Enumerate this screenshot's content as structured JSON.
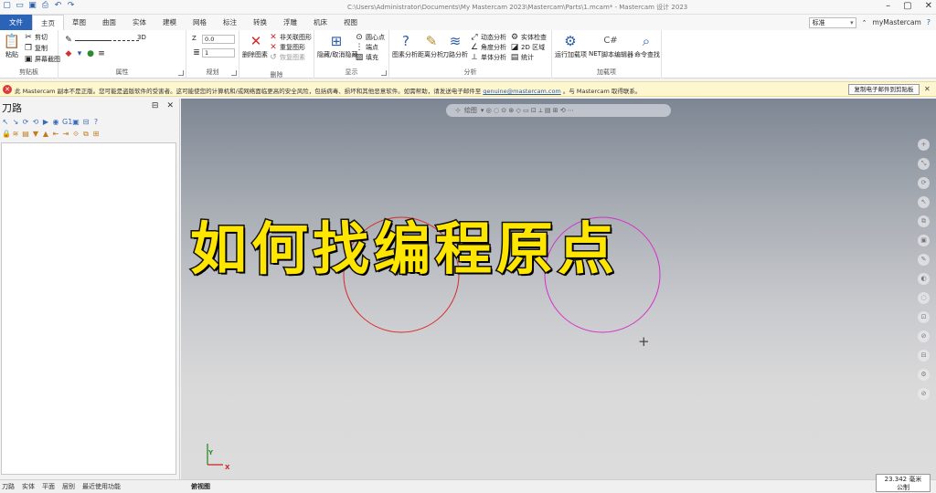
{
  "window": {
    "title": "C:\\Users\\Administrator\\Documents\\My Mastercam 2023\\Mastercam\\Parts\\1.mcam* - Mastercam 设计 2023"
  },
  "qat": {
    "icons": [
      "new-icon",
      "open-icon",
      "save-icon",
      "print-icon",
      "undo-icon",
      "redo-icon"
    ]
  },
  "tabs": [
    "文件",
    "主页",
    "草图",
    "曲面",
    "实体",
    "建模",
    "网格",
    "标注",
    "转换",
    "浮雕",
    "机床",
    "视图"
  ],
  "right_tools": {
    "style_value": "标准",
    "account": "myMastercam"
  },
  "ribbon": {
    "clipboard": {
      "paste": "粘贴",
      "cut": "剪切",
      "copy": "复制",
      "screen_capture": "屏幕截图",
      "label": "剪贴板"
    },
    "attributes": {
      "z_label": "Z",
      "z_value": "0.0",
      "level_value": "1",
      "mode_3d": "3D",
      "label": "属性"
    },
    "plan": {
      "label": "规划"
    },
    "delete": {
      "delete_entity": "删除图素",
      "delete_dup": "非关联图形",
      "dup_geo": "重复图形",
      "restore": "恢复图素",
      "label": "删除"
    },
    "display": {
      "hide": "隐藏/取消隐藏",
      "center": "圆心点",
      "endpoint": "端点",
      "fill": "填充",
      "label": "显示"
    },
    "analyze": {
      "geo_analysis": "图素分析",
      "dist_analysis": "距离分析",
      "toolpath_analysis": "刀路分析",
      "dynamic": "动态分析",
      "angle": "角度分析",
      "unit": "单体分析",
      "check": "实体检查",
      "area_2d": "2D 区域",
      "stats": "统计",
      "label": "分析"
    },
    "addins": {
      "run": "运行加载项",
      "net": "NET",
      "script_editor": "脚本编辑器",
      "cmd_search": "命令查找",
      "label": "加载项"
    }
  },
  "notice": {
    "text_before": "此 Mastercam 副本不是正版。您可能是盗版软件的受害者。这可能使您的计算机和/或网络面临更高的安全风险，包括病毒、损坏和其他恶意软件。如需帮助，请发送电子邮件至",
    "link": "genuine@mastercam.com",
    "text_after": "。与 Mastercam 取得联系。",
    "copy_button": "复制电子邮件到剪贴板"
  },
  "panel": {
    "title": "刀路",
    "ctrl_pin": "⊟",
    "ctrl_close": "✕"
  },
  "viewport": {
    "overlay_text": "如何找编程原点",
    "view_name": "俯视图",
    "axis_x": "X",
    "axis_y": "Y",
    "ctx_bar": "绘图"
  },
  "statusbar": {
    "tabs": [
      "刀路",
      "实体",
      "平面",
      "层别",
      "最近使用功能"
    ],
    "measure_value": "23.342 毫米",
    "measure_unit": "公制"
  },
  "colors": {
    "circle_left": "#d92a2a",
    "circle_right": "#d62fc8",
    "overlay_fill": "#ffe600",
    "file_tab": "#2b63b6"
  }
}
